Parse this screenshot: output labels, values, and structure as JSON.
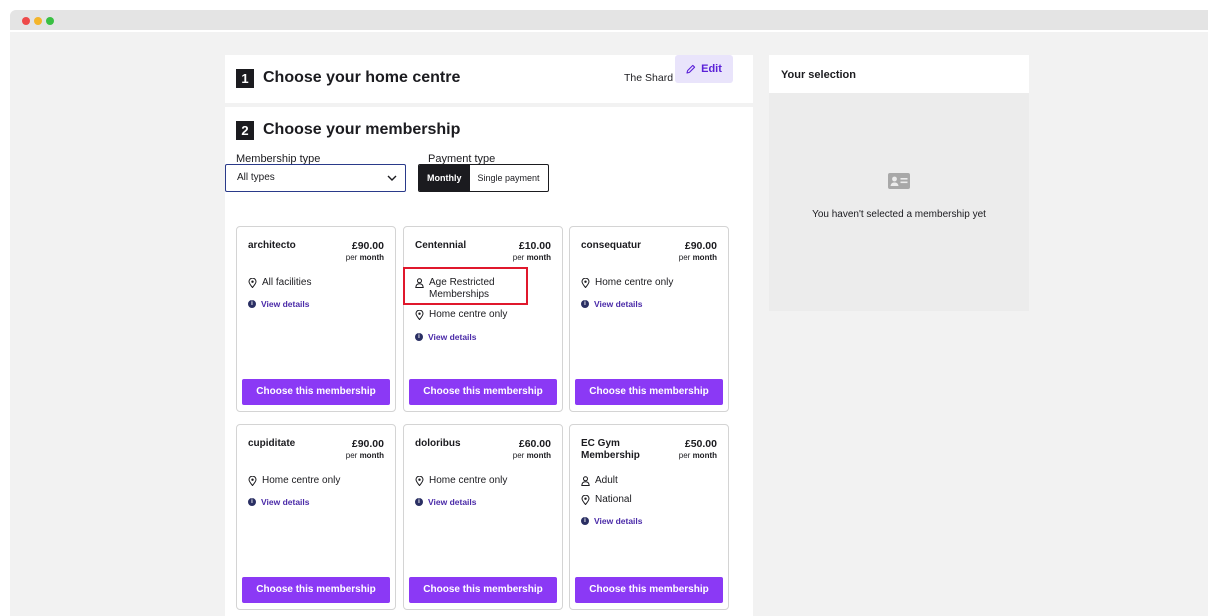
{
  "step1": {
    "number": "1",
    "title": "Choose your home centre",
    "centre": "The Shard",
    "edit_label": "Edit"
  },
  "step2": {
    "number": "2",
    "title": "Choose your membership",
    "membership_type_label": "Membership type",
    "membership_type_value": "All types",
    "payment_type_label": "Payment type",
    "payment_options": [
      "Monthly",
      "Single payment"
    ]
  },
  "common": {
    "per_prefix": "per",
    "per_unit": "month",
    "view_details": "View details",
    "choose_label": "Choose this membership"
  },
  "cards": [
    {
      "name": "architecto",
      "price": "£90.00",
      "features": [
        {
          "icon": "location-pin-icon",
          "text": "All facilities"
        }
      ]
    },
    {
      "name": "Centennial",
      "price": "£10.00",
      "features": [
        {
          "icon": "person-icon",
          "text": "Age Restricted Memberships"
        },
        {
          "icon": "location-pin-icon",
          "text": "Home centre only"
        }
      ]
    },
    {
      "name": "consequatur",
      "price": "£90.00",
      "features": [
        {
          "icon": "location-pin-icon",
          "text": "Home centre only"
        }
      ]
    },
    {
      "name": "cupiditate",
      "price": "£90.00",
      "features": [
        {
          "icon": "location-pin-icon",
          "text": "Home centre only"
        }
      ]
    },
    {
      "name": "doloribus",
      "price": "£60.00",
      "features": [
        {
          "icon": "location-pin-icon",
          "text": "Home centre only"
        }
      ]
    },
    {
      "name": "EC Gym Membership",
      "price": "£50.00",
      "features": [
        {
          "icon": "person-icon",
          "text": "Adult"
        },
        {
          "icon": "location-pin-icon",
          "text": "National"
        }
      ]
    }
  ],
  "selection": {
    "title": "Your selection",
    "empty_text": "You haven't selected a membership yet"
  },
  "colors": {
    "accent": "#8b39f5",
    "link": "#4a2aa8",
    "highlight": "#e0182c",
    "dark": "#1b1b1f"
  }
}
